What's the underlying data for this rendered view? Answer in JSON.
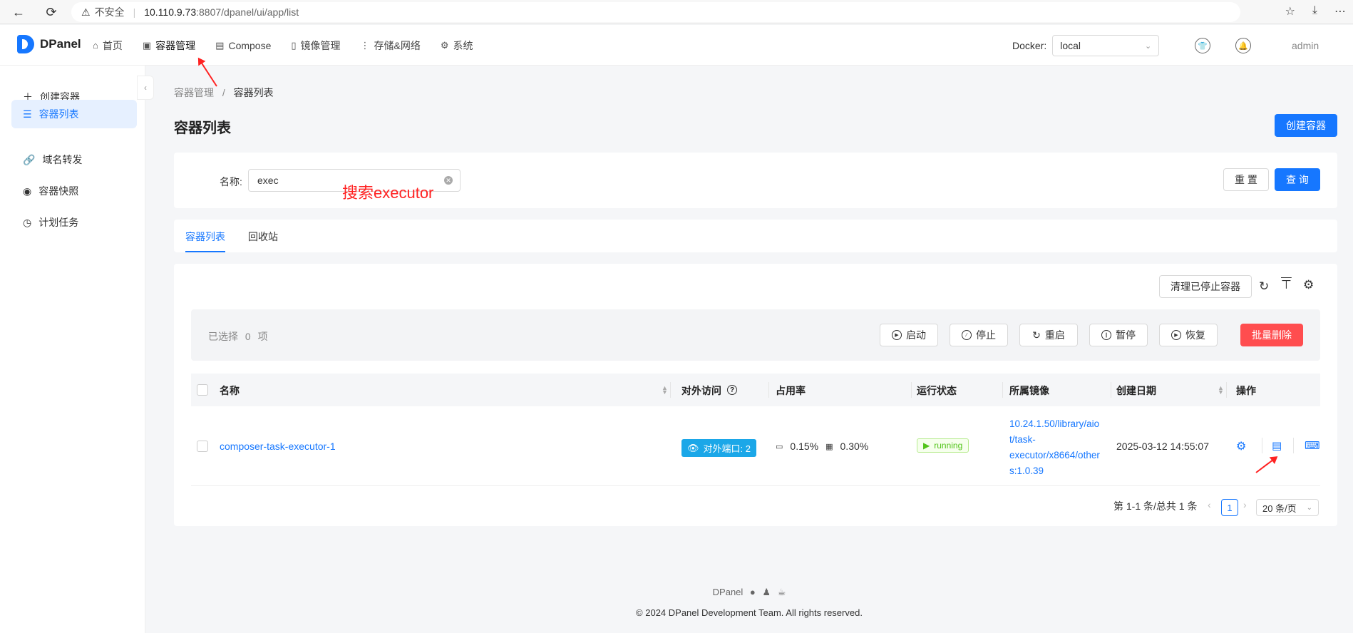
{
  "browser": {
    "security": "不安全",
    "url_host": "10.110.9.73",
    "url_path": ":8807/dpanel/ui/app/list"
  },
  "header": {
    "app_name": "DPanel",
    "nav": [
      {
        "label": "首页",
        "icon": "home-icon"
      },
      {
        "label": "容器管理",
        "icon": "container-icon"
      },
      {
        "label": "Compose",
        "icon": "compose-icon"
      },
      {
        "label": "镜像管理",
        "icon": "image-icon"
      },
      {
        "label": "存储&网络",
        "icon": "more-icon"
      },
      {
        "label": "系统",
        "icon": "gear-icon"
      }
    ],
    "docker_label": "Docker:",
    "docker_value": "local",
    "user": "admin"
  },
  "sidebar": {
    "items": [
      {
        "label": "创建容器",
        "icon": "plus-icon"
      },
      {
        "label": "容器列表",
        "icon": "list-icon"
      },
      {
        "label": "域名转发",
        "icon": "link-icon"
      },
      {
        "label": "容器快照",
        "icon": "camera-icon"
      },
      {
        "label": "计划任务",
        "icon": "clock-icon"
      }
    ]
  },
  "main": {
    "breadcrumb_parent": "容器管理",
    "breadcrumb_sep": "/",
    "breadcrumb_current": "容器列表",
    "title": "容器列表",
    "create_button": "创建容器",
    "search": {
      "label": "名称:",
      "value": "exec",
      "annotation": "搜索executor",
      "reset": "重 置",
      "query": "查 询"
    },
    "tabs": [
      "容器列表",
      "回收站"
    ],
    "clean_button": "清理已停止容器",
    "batch": {
      "selected_prefix": "已选择",
      "selected_count": "0",
      "selected_suffix": "项",
      "start": "启动",
      "stop": "停止",
      "restart": "重启",
      "pause": "暂停",
      "resume": "恢复",
      "delete": "批量删除"
    },
    "table": {
      "headers": [
        "名称",
        "对外访问",
        "占用率",
        "运行状态",
        "所属镜像",
        "创建日期",
        "操作"
      ],
      "rows": [
        {
          "name": "composer-task-executor-1",
          "ports": "对外端口: 2",
          "cpu": "0.15%",
          "mem": "0.30%",
          "status": "running",
          "image_lines": [
            "10.24.1.50/library/aio",
            "t/task-",
            "executor/x8664/other",
            "s:1.0.39"
          ],
          "created": "2025-03-12 14:55:07"
        }
      ]
    },
    "pagination": {
      "summary": "第 1-1 条/总共 1 条",
      "page": "1",
      "page_size": "20 条/页"
    }
  },
  "footer": {
    "brand": "DPanel",
    "copyright": "© 2024 DPanel Development Team. All rights reserved."
  },
  "colors": {
    "primary": "#1677ff",
    "danger": "#ff4d4f",
    "running": "#52c41a",
    "port_tag": "#1ba7e8",
    "annotation": "#ff2222"
  }
}
